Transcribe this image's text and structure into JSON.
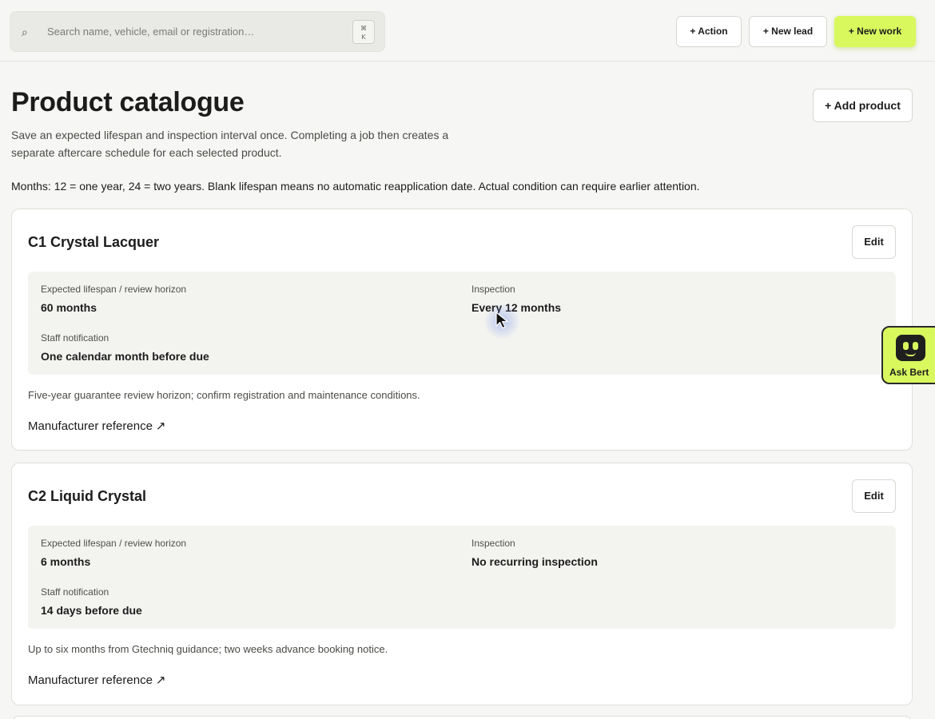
{
  "search": {
    "placeholder": "Search name, vehicle, email or registration…",
    "shortcut_line1": "⌘",
    "shortcut_line2": "K"
  },
  "header_actions": {
    "action": "+ Action",
    "new_lead": "+ New lead",
    "new_work": "+ New work"
  },
  "page": {
    "title": "Product catalogue",
    "intro_line1": "Save an expected lifespan and inspection interval once. Completing a job then creates a",
    "intro_line2": "separate aftercare schedule for each selected product.",
    "add_product": "+ Add product",
    "months_note": "Months: 12 = one year, 24 = two years. Blank lifespan means no automatic reapplication date. Actual condition can require earlier attention."
  },
  "labels": {
    "lifespan": "Expected lifespan / review horizon",
    "inspection": "Inspection",
    "staff_notification": "Staff notification",
    "edit": "Edit",
    "manufacturer_reference": "Manufacturer reference",
    "external_link_glyph": "↗"
  },
  "products": [
    {
      "name": "C1 Crystal Lacquer",
      "lifespan": "60 months",
      "inspection": "Every 12 months",
      "staff_notification": "One calendar month before due",
      "notes": "Five-year guarantee review horizon; confirm registration and maintenance conditions."
    },
    {
      "name": "C2 Liquid Crystal",
      "lifespan": "6 months",
      "inspection": "No recurring inspection",
      "staff_notification": "14 days before due",
      "notes": "Up to six months from Gtechniq guidance; two weeks advance booking notice."
    }
  ],
  "assistant": {
    "label": "Ask Bert"
  },
  "colors": {
    "accent": "#d8f85e",
    "background": "#f6f6f4",
    "card": "#ffffff",
    "info_panel": "#f3f3f0"
  },
  "icons": {
    "search": "search-icon",
    "external_link": "external-link-icon",
    "assistant": "bert-robot-icon",
    "cursor": "mouse-pointer-icon"
  }
}
